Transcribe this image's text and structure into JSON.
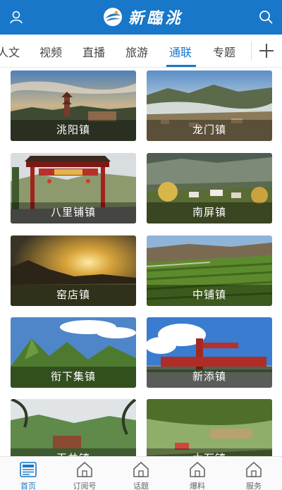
{
  "header": {
    "logo_text": "新臨洮",
    "colors": {
      "bar": "#1877c8"
    },
    "icons": {
      "left": "user-icon",
      "right": "search-icon"
    }
  },
  "tabs": {
    "items": [
      {
        "label": "人文"
      },
      {
        "label": "视频"
      },
      {
        "label": "直播"
      },
      {
        "label": "旅游"
      },
      {
        "label": "通联",
        "active": true
      },
      {
        "label": "专题"
      }
    ],
    "add_icon": "plus-icon"
  },
  "towns": [
    {
      "label": "洮阳镇"
    },
    {
      "label": "龙门镇"
    },
    {
      "label": "八里铺镇"
    },
    {
      "label": "南屏镇"
    },
    {
      "label": "窑店镇"
    },
    {
      "label": "中铺镇"
    },
    {
      "label": "衔下集镇"
    },
    {
      "label": "新添镇"
    },
    {
      "label": "玉井镇"
    },
    {
      "label": "太石镇"
    }
  ],
  "bottom_nav": {
    "items": [
      {
        "label": "首页",
        "icon": "news-icon",
        "active": true
      },
      {
        "label": "订阅号",
        "icon": "home-icon"
      },
      {
        "label": "话题",
        "icon": "home-icon"
      },
      {
        "label": "爆料",
        "icon": "home-icon"
      },
      {
        "label": "服务",
        "icon": "home-icon"
      }
    ],
    "active_color": "#1877c8"
  }
}
